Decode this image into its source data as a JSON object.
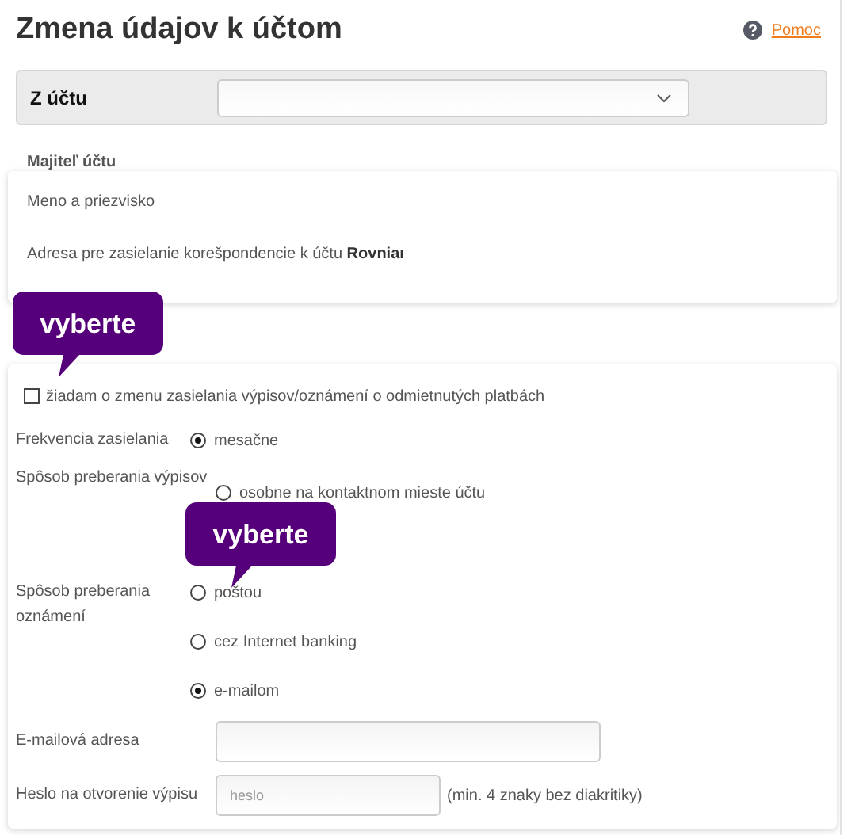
{
  "header": {
    "title": "Zmena údajov k účtom",
    "help_link": "Pomoc"
  },
  "account": {
    "label": "Z účtu"
  },
  "owner": {
    "heading": "Majiteľ účtu",
    "name_label": "Meno a priezvisko",
    "address_text": "Adresa pre zasielanie korešpondencie k účtu **Rovniaı**"
  },
  "change_request": {
    "label": "žiadam o zmenu zasielania výpisov/oznámení o odmietnutých platbách",
    "checked": false
  },
  "fields": [
    {
      "kind": "radio",
      "label": "Frekvencia zasielania",
      "options": [
        {
          "label": "mesačne",
          "selected": true
        }
      ]
    },
    {
      "kind": "radio",
      "label": "Spôsob preberania výpisov",
      "options": [
        {
          "label": "osobne na kontaktnom mieste účtu",
          "selected": false
        }
      ]
    },
    {
      "kind": "radio",
      "label": "Spôsob preberania oznámení",
      "options": [
        {
          "label": "poštou",
          "selected": false
        },
        {
          "label": "cez Internet banking",
          "selected": false
        },
        {
          "label": "e-mailom",
          "selected": true
        }
      ]
    },
    {
      "kind": "text",
      "label": "E-mailová adresa"
    },
    {
      "kind": "text",
      "label": "Heslo na otvorenie výpisu",
      "placeholder": "heslo",
      "note": "(min. 4 znaky bez diakritiky)"
    }
  ],
  "tooltips": [
    {
      "text": "vyberte"
    },
    {
      "text": "vyberte"
    }
  ]
}
